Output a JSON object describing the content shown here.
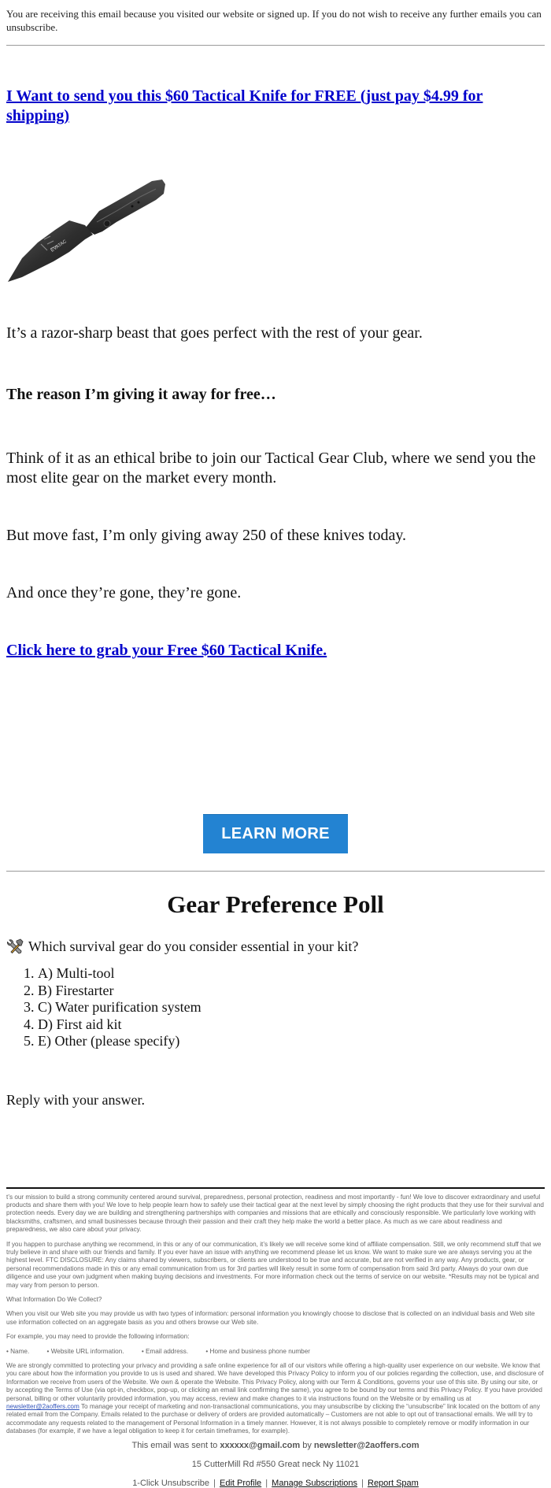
{
  "preheader": {
    "text": "You are receiving this email because you visited our website or signed up. If you do not wish to receive any further emails you can unsubscribe."
  },
  "headline": {
    "text": "I Want to send you this $60 Tactical Knife for FREE (just pay $4.99 for shipping)"
  },
  "product_image": {
    "alt": "Tactical folding knife",
    "blade_text": "EVATAC"
  },
  "body": {
    "p1": "It’s a razor-sharp beast that goes perfect with the rest of your gear.",
    "p2": "The reason I’m giving it away for free…",
    "p3": "Think of it as an ethical bribe to join our Tactical Gear Club, where we send you the most elite gear on the market every month.",
    "p4": "But move fast, I’m only giving away 250 of these knives today.",
    "p5": "And once they’re gone, they’re gone.",
    "cta_link": "Click here to grab your Free $60 Tactical Knife."
  },
  "learn_more": {
    "label": "LEARN MORE",
    "color": "#2383d2"
  },
  "poll": {
    "title": "Gear Preference Poll",
    "icon": "hammer-and-wrench-icon",
    "question": "Which survival gear do you consider essential in your kit?",
    "options": [
      "A) Multi-tool",
      "B) Firestarter",
      "C) Water purification system",
      "D) First aid kit",
      "E) Other (please specify)"
    ],
    "reply_prompt": "Reply with your answer."
  },
  "footer": {
    "mission": "t’s our mission to build a strong community centered around survival, preparedness, personal protection, readiness and most importantly - fun! We love to discover extraordinary and useful products and share them with you! We love to help people learn how to safely use their tactical gear at the next level by simply choosing the right products that they use for their survival and protection needs. Every day we are building and strengthening partnerships with companies and missions that are ethically and consciously responsible. We particularly love working with blacksmiths, craftsmen, and small businesses because through their passion and their craft they help make the world a better place. As much as we care about readiness and preparedness, we also care about your privacy.",
    "disclosure": "If you happen to purchase anything we recommend, in this or any of our communication, it’s likely we will receive some kind of affiliate compensation. Still, we only recommend stuff that we truly believe in and share with our friends and family. If you ever have an issue with anything we recommend please let us know. We want to make sure we are always serving you at the highest level. FTC DISCLOSURE: Any claims shared by viewers, subscribers, or clients are understood to be true and accurate, but are not verified in any way. Any products, gear, or personal recommendations made in this or any email communication from us for 3rd parties will likely result in some form of compensation from said 3rd party. Always do your own due diligence and use your own judgment when making buying decisions and investments. For more information check out the terms of service on our website. *Results may not be typical and may vary from person to person.",
    "collect_heading": "What Information Do We Collect?",
    "collect_text": "When you visit our Web site you may provide us with two types of information: personal information you knowingly choose to disclose that is collected on an individual basis and Web site use information collected on an aggregate basis as you and others browse our Web site.",
    "example_text": "For example, you may need to provide the following information:",
    "bullets": [
      "• Name.",
      "• Website URL information.",
      "• Email address.",
      "• Home and business phone number"
    ],
    "privacy_text_before": "We are strongly committed to protecting your privacy and providing a safe online experience for all of our visitors while offering a high-quality user experience on our website. We know that you care about how the information you provide to us is used and shared. We have developed this Privacy Policy to inform you of our policies regarding the collection, use, and disclosure of Information we receive from users of the Website. We own & operate the Website. This Privacy Policy, along with our Term & Conditions, governs your use of this site. By using our site, or by accepting the Terms of Use (via opt-in, checkbox, pop-up, or clicking an email link confirming the same), you agree to be bound by our terms and this Privacy Policy. If you have provided personal, billing or other voluntarily provided information, you may access, review and make changes to it via instructions found on the Website or by emailing us at ",
    "privacy_email": "newsletter@2aoffers.com",
    "privacy_text_after": " To manage your receipt of marketing and non-transactional communications, you may unsubscribe by clicking the “unsubscribe” link located on the bottom of any related email from the Company. Emails related to the purchase or delivery of orders are provided automatically – Customers are not able to opt out of transactional emails. We will try to accommodate any requests related to the management of Personal Information in a timely manner. However, it is not always possible to completely remove or modify information in our databases (for example, if we have a legal obligation to keep it for certain timeframes, for example).",
    "sent_prefix": "This email was sent to ",
    "recipient": "xxxxxx@gmail.com",
    "sent_by": " by ",
    "sender": "newsletter@2aoffers.com",
    "address": "15 CutterMill Rd #550 Great neck Ny 11021",
    "unsubscribe": "1-Click Unsubscribe",
    "edit_profile": "Edit Profile",
    "manage_subscriptions": "Manage Subscriptions",
    "report_spam": "Report Spam",
    "separator": "|"
  }
}
